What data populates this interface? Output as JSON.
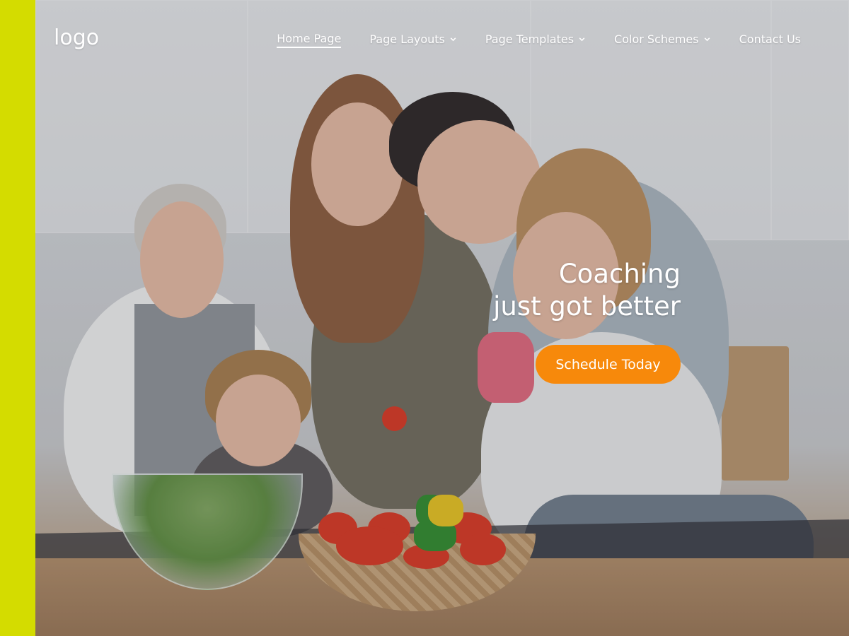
{
  "brand": {
    "logo_text": "logo",
    "accent_color": "#d4dc00",
    "cta_color": "#f7890b"
  },
  "nav": {
    "items": [
      {
        "label": "Home Page",
        "active": true,
        "has_dropdown": false
      },
      {
        "label": "Page Layouts",
        "active": false,
        "has_dropdown": true
      },
      {
        "label": "Page Templates",
        "active": false,
        "has_dropdown": true
      },
      {
        "label": "Color Schemes",
        "active": false,
        "has_dropdown": true
      },
      {
        "label": "Contact Us",
        "active": false,
        "has_dropdown": false
      }
    ]
  },
  "hero": {
    "headline_line1": "Coaching",
    "headline_line2": "just got better",
    "cta_label": "Schedule Today",
    "background_image": "family-cooking-in-kitchen-photo"
  }
}
